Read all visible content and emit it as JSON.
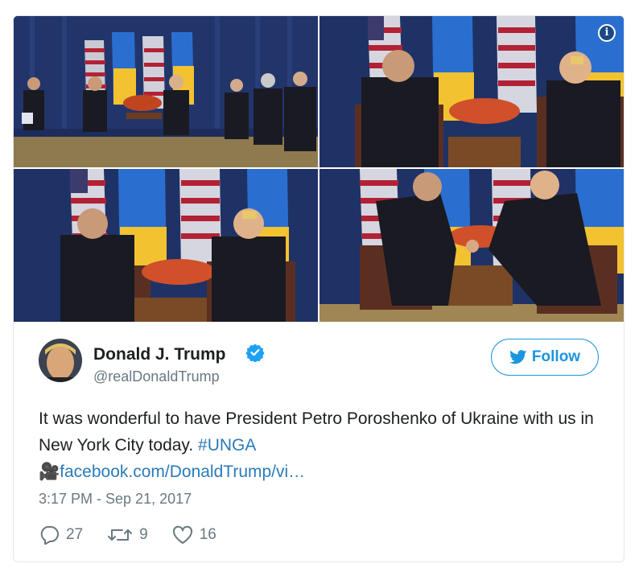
{
  "tweet": {
    "author_name": "Donald J. Trump",
    "handle": "@realDonaldTrump",
    "follow_label": "Follow",
    "text_main": "It was wonderful to have President Petro Poroshenko of Ukraine with us in New York City today. ",
    "hashtag": "#UNGA",
    "link_emoji": "🎥",
    "link_text": "facebook.com/DonaldTrump/vi…",
    "timestamp": "3:17 PM - Sep 21, 2017",
    "replies": "27",
    "retweets": "9",
    "likes": "16"
  },
  "icons": {
    "info": "info-icon",
    "verified": "verified-badge-icon",
    "twitter": "twitter-bird-icon",
    "reply": "reply-icon",
    "retweet": "retweet-icon",
    "like": "heart-icon",
    "video": "video-camera-icon"
  },
  "colors": {
    "accent": "#1b95e0",
    "link": "#2b7bb9",
    "text": "#1c2022",
    "muted": "#697882",
    "border": "#e1e8ed"
  }
}
